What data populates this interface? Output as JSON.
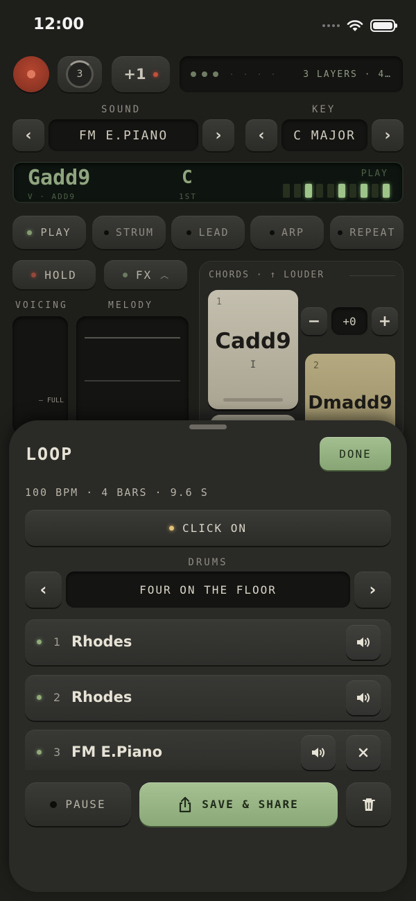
{
  "status_bar": {
    "time": "12:00"
  },
  "top": {
    "count_badge": "3",
    "plus_label": "+1",
    "layers_text": "3 LAYERS · 4…",
    "sound": {
      "label": "SOUND",
      "value": "FM E.PIANO"
    },
    "key": {
      "label": "KEY",
      "value": "C MAJOR"
    },
    "display": {
      "chord": "Gadd9",
      "chord_sub": "V · ADD9",
      "note": "C",
      "note_sub": "1ST",
      "mode": "PLAY"
    },
    "modes": [
      "PLAY",
      "STRUM",
      "LEAD",
      "ARP",
      "REPEAT"
    ],
    "hold_label": "HOLD",
    "fx_label": "FX",
    "voicing_label": "VOICING",
    "voicing_marker": "— FULL",
    "melody_label": "MELODY",
    "chords_header": "CHORDS · ↑ LOUDER",
    "transpose_value": "+0",
    "chord_cards": [
      {
        "num": "1",
        "name": "Cadd9",
        "roman": "I"
      },
      {
        "num": "2",
        "name": "Dmadd9"
      }
    ]
  },
  "loop": {
    "title": "LOOP",
    "done_label": "DONE",
    "info": "100 BPM · 4 BARS · 9.6 S",
    "click_label": "CLICK ON",
    "drums_label": "DRUMS",
    "drums_value": "FOUR ON THE FLOOR",
    "tracks": [
      {
        "num": "1",
        "name": "Rhodes"
      },
      {
        "num": "2",
        "name": "Rhodes"
      },
      {
        "num": "3",
        "name": "FM E.Piano"
      }
    ],
    "pause_label": "PAUSE",
    "save_label": "SAVE & SHARE"
  },
  "colors": {
    "accent_green": "#9db98a",
    "record_red": "#b4452f",
    "chord_card_1": "#b8b2a0",
    "chord_card_2": "#a89c76"
  }
}
